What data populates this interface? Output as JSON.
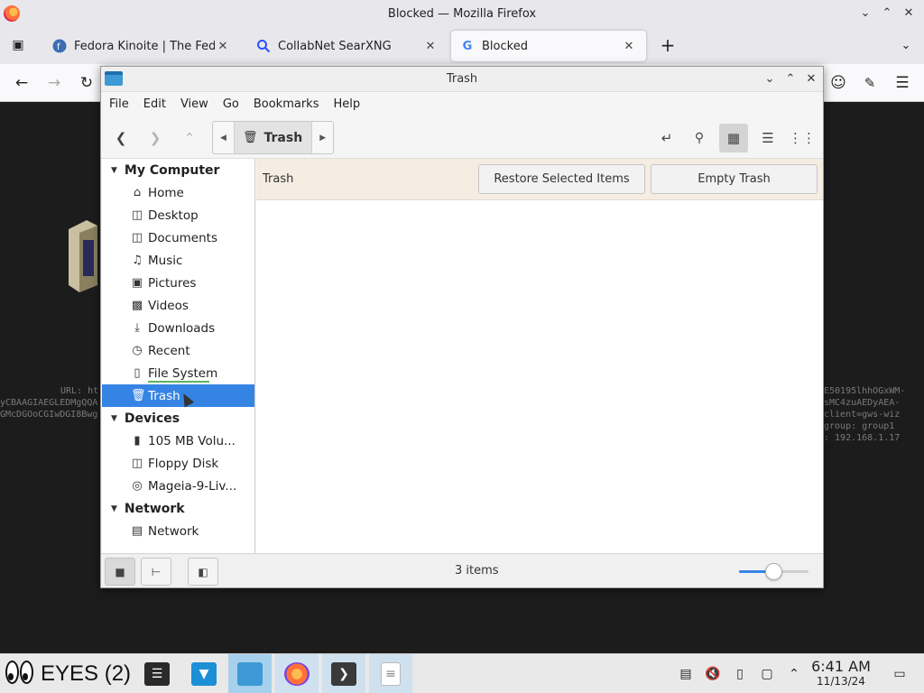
{
  "firefox": {
    "window_title": "Blocked — Mozilla Firefox",
    "tabs": [
      {
        "label": "Fedora Kinoite | The Fedora",
        "icon": "fedora-icon"
      },
      {
        "label": "CollabNet SearXNG",
        "icon": "search-icon"
      },
      {
        "label": "Blocked",
        "icon": "google-icon"
      }
    ]
  },
  "background": {
    "url_label": "URL: ht",
    "left_lines": [
      "yCBAAGIAEGLEDMgQQA",
      "GMcDGOoCGIwDGI8Bwg"
    ],
    "right_lines": [
      "E50195lhhOGxWM-",
      "sMC4zuAEDyAEA-",
      "client=gws-wiz",
      "group: group1",
      ": 192.168.1.17"
    ]
  },
  "nemo": {
    "title": "Trash",
    "menu": [
      "File",
      "Edit",
      "View",
      "Go",
      "Bookmarks",
      "Help"
    ],
    "breadcrumb": "Trash",
    "sidebar": {
      "sections": [
        {
          "header": "My Computer",
          "items": [
            {
              "label": "Home",
              "icon": "home-icon"
            },
            {
              "label": "Desktop",
              "icon": "desktop-icon"
            },
            {
              "label": "Documents",
              "icon": "documents-icon"
            },
            {
              "label": "Music",
              "icon": "music-icon"
            },
            {
              "label": "Pictures",
              "icon": "pictures-icon"
            },
            {
              "label": "Videos",
              "icon": "videos-icon"
            },
            {
              "label": "Downloads",
              "icon": "downloads-icon"
            },
            {
              "label": "Recent",
              "icon": "recent-icon"
            },
            {
              "label": "File System",
              "icon": "drive-icon"
            },
            {
              "label": "Trash",
              "icon": "trash-icon",
              "selected": true
            }
          ]
        },
        {
          "header": "Devices",
          "items": [
            {
              "label": "105 MB Volu...",
              "icon": "usb-icon"
            },
            {
              "label": "Floppy Disk",
              "icon": "floppy-icon"
            },
            {
              "label": "Mageia-9-Liv...",
              "icon": "disc-icon"
            }
          ]
        },
        {
          "header": "Network",
          "items": [
            {
              "label": "Network",
              "icon": "network-icon"
            }
          ]
        }
      ]
    },
    "content": {
      "header_title": "Trash",
      "restore_label": "Restore Selected Items",
      "empty_label": "Empty Trash"
    },
    "status": {
      "items_text": "3 items",
      "zoom_level": 0.5
    }
  },
  "taskbar": {
    "eyes_label": "EYES (2)",
    "clock_time": "6:41 AM",
    "clock_date": "11/13/24"
  }
}
